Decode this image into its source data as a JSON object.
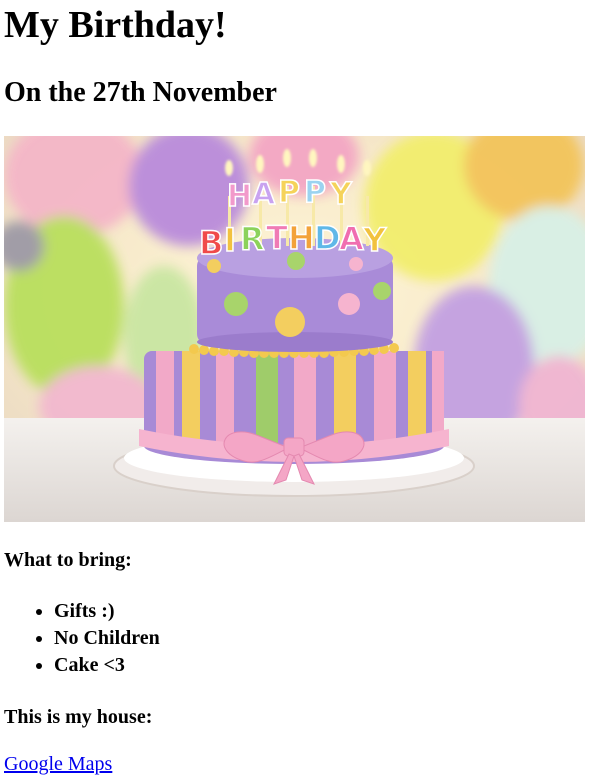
{
  "page": {
    "title": "My Birthday!",
    "date_heading": "On the 27th November",
    "bring_heading": "What to bring:",
    "bring_items": [
      "Gifts :)",
      "No Children",
      "Cake <3"
    ],
    "house_heading": "This is my house:",
    "maps_link_text": "Google Maps"
  },
  "image": {
    "cake_topper_text": "HAPPY BIRTHDAY",
    "colors": {
      "cake_purple": "#a98ad6",
      "pink": "#f7b5cf",
      "yellow": "#f2c85a",
      "green": "#a8d46b",
      "plate": "#f3f0ee"
    }
  }
}
